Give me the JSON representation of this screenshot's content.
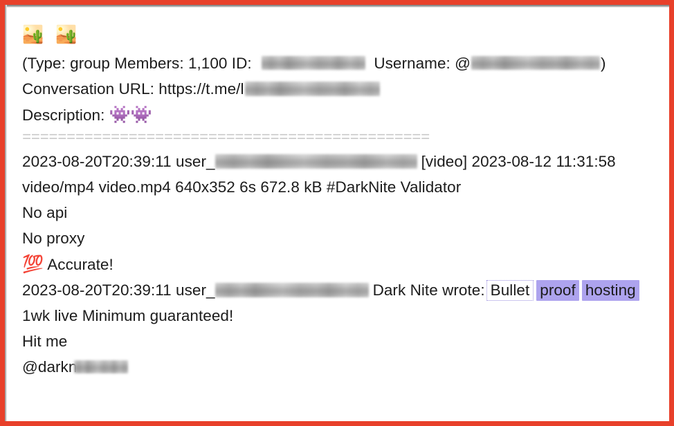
{
  "colors": {
    "frame_border": "#e8402a",
    "highlight": "#ada3ee",
    "highlight_active_border": "#9a8fe0",
    "text": "#1c1c1c"
  },
  "header": {
    "emoji_line": "🏜️ 🏜️",
    "emoji_names": [
      "desert-emoji",
      "desert-emoji"
    ],
    "meta_open_paren": "(Type: group Members: 1,100 ID:",
    "type_label": "Type:",
    "type_value": "group",
    "members_label": "Members:",
    "members_value": "1,100",
    "id_label": "ID:",
    "id_value_redacted": true,
    "username_label": "Username: @",
    "username_value_redacted": true,
    "meta_close_paren": ")",
    "conversation_url_label": "Conversation URL:",
    "conversation_url_value": "https://t.me/l",
    "conversation_url_redacted": true,
    "description_label": "Description:",
    "description_emoji": "👾👾",
    "description_emoji_names": [
      "alien-monster-emoji",
      "alien-monster-emoji"
    ],
    "separator": "=============================================="
  },
  "messages": [
    {
      "timestamp": "2023-08-20T20:39:11",
      "user_prefix": "user_",
      "user_redacted": true,
      "attachment_tag": "[video]",
      "attachment_date": "2023-08-12",
      "attachment_time": "11:31:58",
      "mime_type": "video/mp4",
      "file_name": "video.mp4",
      "resolution": "640x352",
      "duration": "6s",
      "file_size": "672.8 kB",
      "hashtag": "#DarkNite",
      "caption_suffix": "Validator",
      "body_lines": [
        "No api",
        "No proxy"
      ],
      "accurate_emoji": "💯",
      "accurate_emoji_name": "hundred-points-emoji",
      "accurate_text": "Accurate!"
    },
    {
      "timestamp": "2023-08-20T20:39:11",
      "user_prefix": "user_",
      "user_redacted": true,
      "author": "Dark Nite",
      "wrote_label": "wrote:",
      "highlight_active": "Bullet",
      "highlight_second": "proof",
      "highlight_third": "hosting",
      "body_lines": [
        "1wk live Minimum guaranteed!",
        "Hit me"
      ],
      "handle_prefix": "@darkn",
      "handle_redacted": true
    }
  ]
}
